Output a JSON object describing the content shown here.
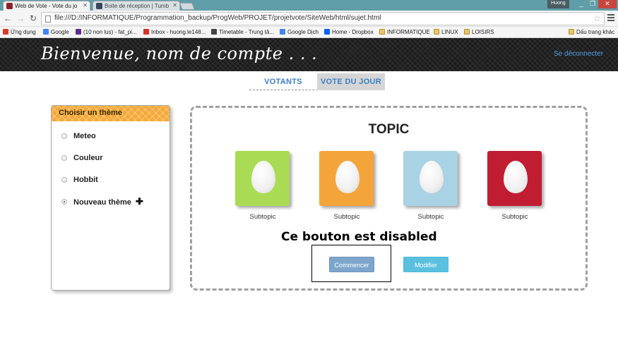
{
  "browser": {
    "tabs": [
      {
        "label": "Web de Vote - Vote du jo",
        "active": true,
        "color": "#8b1f2a"
      },
      {
        "label": "Boite de réception | Tumb",
        "active": false,
        "color": "#35465c"
      }
    ],
    "user_badge": "Huong",
    "window_buttons": [
      "_",
      "❐",
      "✕"
    ],
    "url": "file:///D:/INFORMATIQUE/Programmation_backup/ProgWeb/PROJET/projetvote/SiteWeb/html/sujet.html",
    "bookmarks": [
      {
        "label": "Ứng dụng",
        "icon": "apps-grid-icon",
        "color": "#d93b2b"
      },
      {
        "label": "Google",
        "icon": "google-icon",
        "color": "#4285f4"
      },
      {
        "label": "(10 non lus) - fat_pi...",
        "icon": "yahoo-mail-icon",
        "color": "#5c2d91"
      },
      {
        "label": "Inbox - huong.le148...",
        "icon": "gmail-icon",
        "color": "#d93025"
      },
      {
        "label": "Timetable - Trung tâ...",
        "icon": "timetable-icon",
        "color": "#444444"
      },
      {
        "label": "Google Dịch",
        "icon": "google-translate-icon",
        "color": "#4285f4"
      },
      {
        "label": "Home - Dropbox",
        "icon": "dropbox-icon",
        "color": "#0061fe"
      },
      {
        "label": "INFORMATIQUE",
        "icon": "folder-icon",
        "color": "#e9c46a"
      },
      {
        "label": "LINUX",
        "icon": "folder-icon",
        "color": "#e9c46a"
      },
      {
        "label": "LOISIRS",
        "icon": "folder-icon",
        "color": "#e9c46a"
      },
      {
        "label": "Dấu trang khác",
        "icon": "folder-icon",
        "color": "#e9c46a"
      }
    ]
  },
  "header": {
    "welcome": "Bienvenue, nom de compte . . .",
    "logout": "Se déconnecter"
  },
  "nav": {
    "tabs": [
      {
        "label": "VOTANTS",
        "active": false
      },
      {
        "label": "VOTE DU JOUR",
        "active": true
      }
    ]
  },
  "sidebar": {
    "title": "Choisir un thème",
    "items": [
      {
        "label": "Meteo",
        "checked": false
      },
      {
        "label": "Couleur",
        "checked": false
      },
      {
        "label": "Hobbit",
        "checked": false
      },
      {
        "label": "Nouveau thème",
        "checked": true,
        "icon": "plus-icon"
      }
    ],
    "header_color": "#f4a837"
  },
  "main": {
    "title": "TOPIC",
    "cards": [
      {
        "label": "Subtopic",
        "color": "#a9dc54"
      },
      {
        "label": "Subtopic",
        "color": "#f3a43a"
      },
      {
        "label": "Subtopic",
        "color": "#a9d2e4"
      },
      {
        "label": "Subtopic",
        "color": "#c01d33"
      }
    ],
    "note": "Ce bouton est disabled",
    "buttons": {
      "start": {
        "label": "Commencer",
        "disabled": true
      },
      "modify": {
        "label": "Modifier",
        "disabled": false
      }
    }
  }
}
